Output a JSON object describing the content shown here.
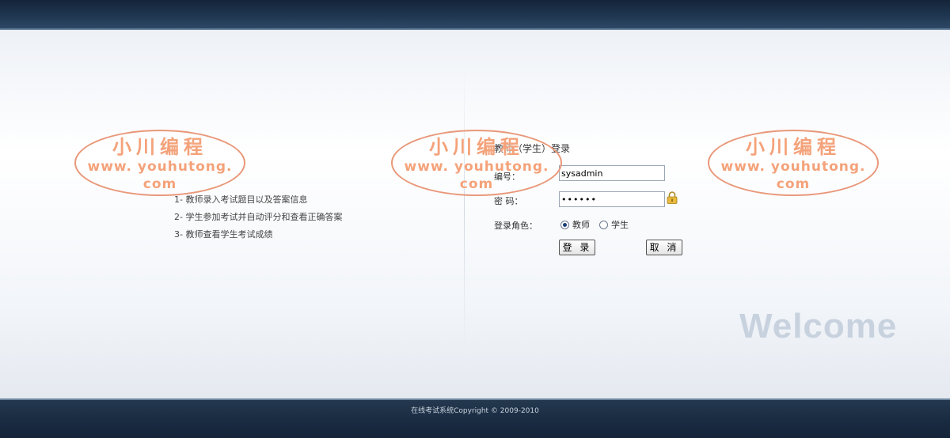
{
  "header": {},
  "features": [
    "1- 教师录入考试题目以及答案信息",
    "2- 学生参加考试并自动评分和查看正确答案",
    "3- 教师查看学生考试成绩"
  ],
  "login": {
    "title": "教师（学生）登录",
    "id_label": "编号：",
    "id_value": "sysadmin",
    "password_label": "密 码：",
    "password_value": "••••••",
    "role_label": "登录角色：",
    "role_options": [
      "教师",
      "学生"
    ],
    "role_selected": "教师",
    "login_button": "登 录",
    "cancel_button": "取 消"
  },
  "welcome_text": "Welcome",
  "footer": {
    "copyright": "在线考试系统Copyright © 2009-2010"
  },
  "watermark": {
    "line1": "小川编程",
    "line2": "www. youhutong. com"
  },
  "colors": {
    "top_bar": "#1f3650",
    "bottom_bar": "#1a2c42",
    "watermark": "#f19a6f",
    "welcome": "#c2cddb"
  }
}
